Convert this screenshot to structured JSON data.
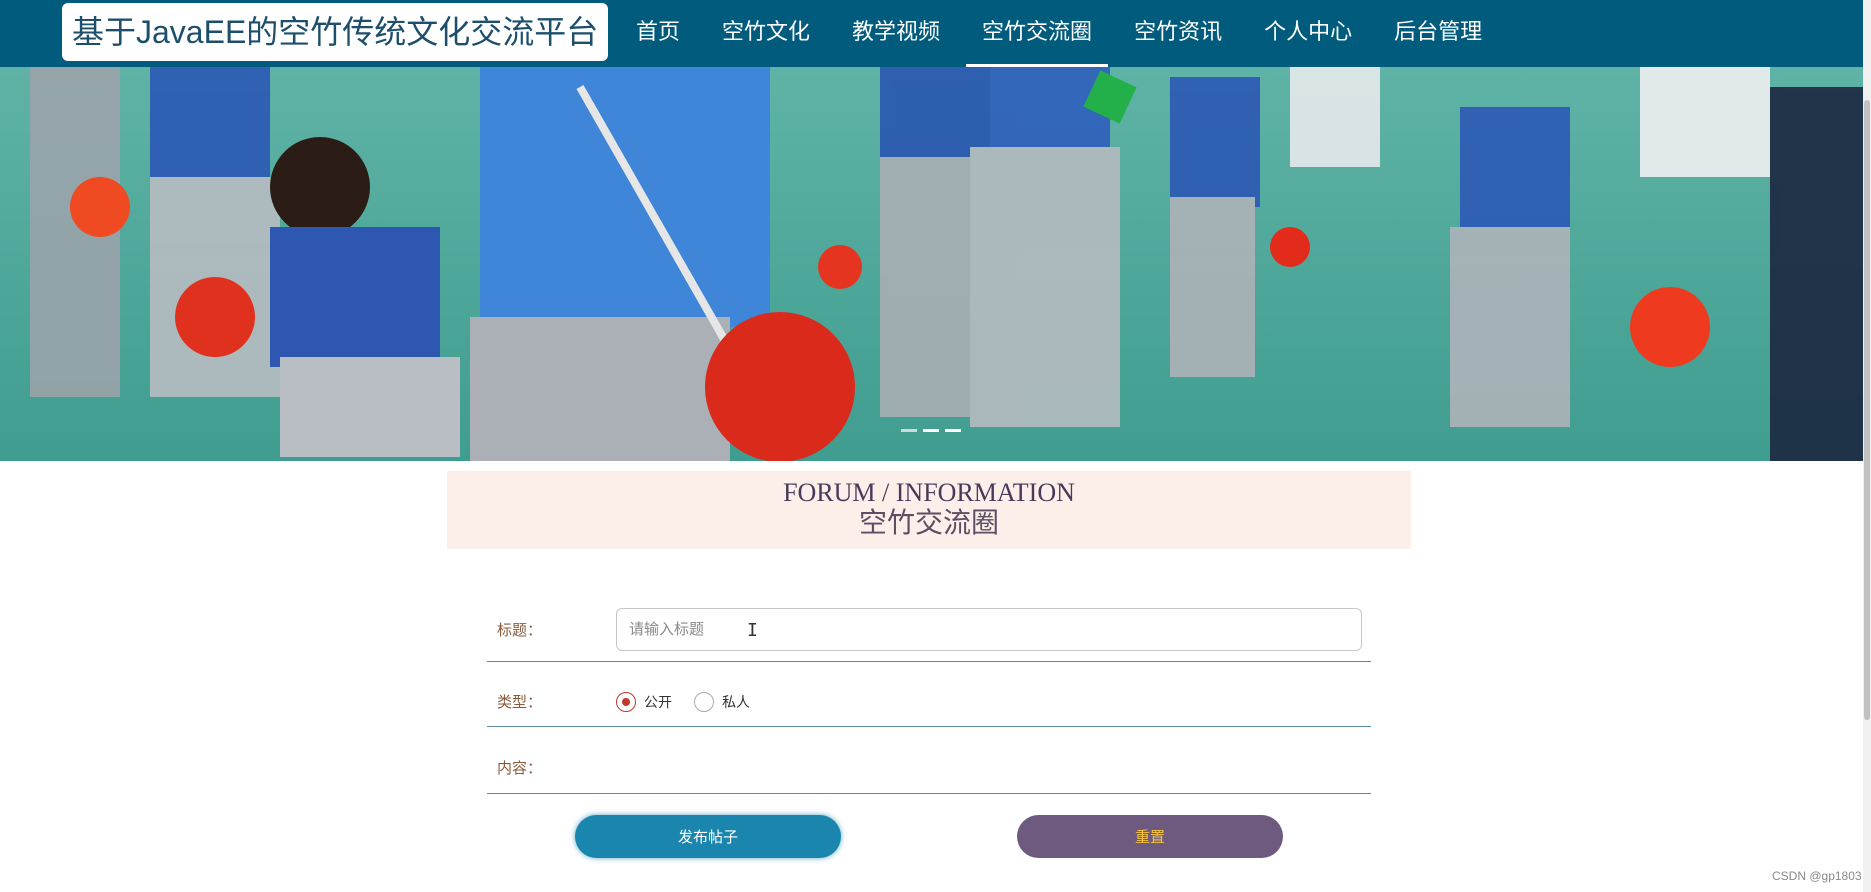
{
  "header": {
    "brand_title": "基于JavaEE的空竹传统文化交流平台",
    "nav": [
      {
        "label": "首页",
        "active": false
      },
      {
        "label": "空竹文化",
        "active": false
      },
      {
        "label": "教学视频",
        "active": false
      },
      {
        "label": "空竹交流圈",
        "active": true
      },
      {
        "label": "空竹资讯",
        "active": false
      },
      {
        "label": "个人中心",
        "active": false
      },
      {
        "label": "后台管理",
        "active": false
      }
    ]
  },
  "banner": {
    "slide_indicators": 3,
    "active_indicator": 0
  },
  "section": {
    "title_en": "FORUM / INFORMATION",
    "title_cn": "空竹交流圈"
  },
  "form": {
    "title_label": "标题：",
    "title_value": "",
    "title_placeholder": "请输入标题",
    "type_label": "类型：",
    "type_options": [
      "公开",
      "私人"
    ],
    "type_selected": "公开",
    "content_label": "内容：",
    "submit_label": "发布帖子",
    "reset_label": "重置"
  },
  "watermark": "CSDN @gp1803",
  "colors": {
    "nav_bg": "#005b7d",
    "submit_bg": "#1a86ad",
    "reset_bg": "#6e5a7e",
    "reset_text": "#f5c242",
    "section_bg": "#fcefea",
    "radio_checked": "#c0392b"
  }
}
